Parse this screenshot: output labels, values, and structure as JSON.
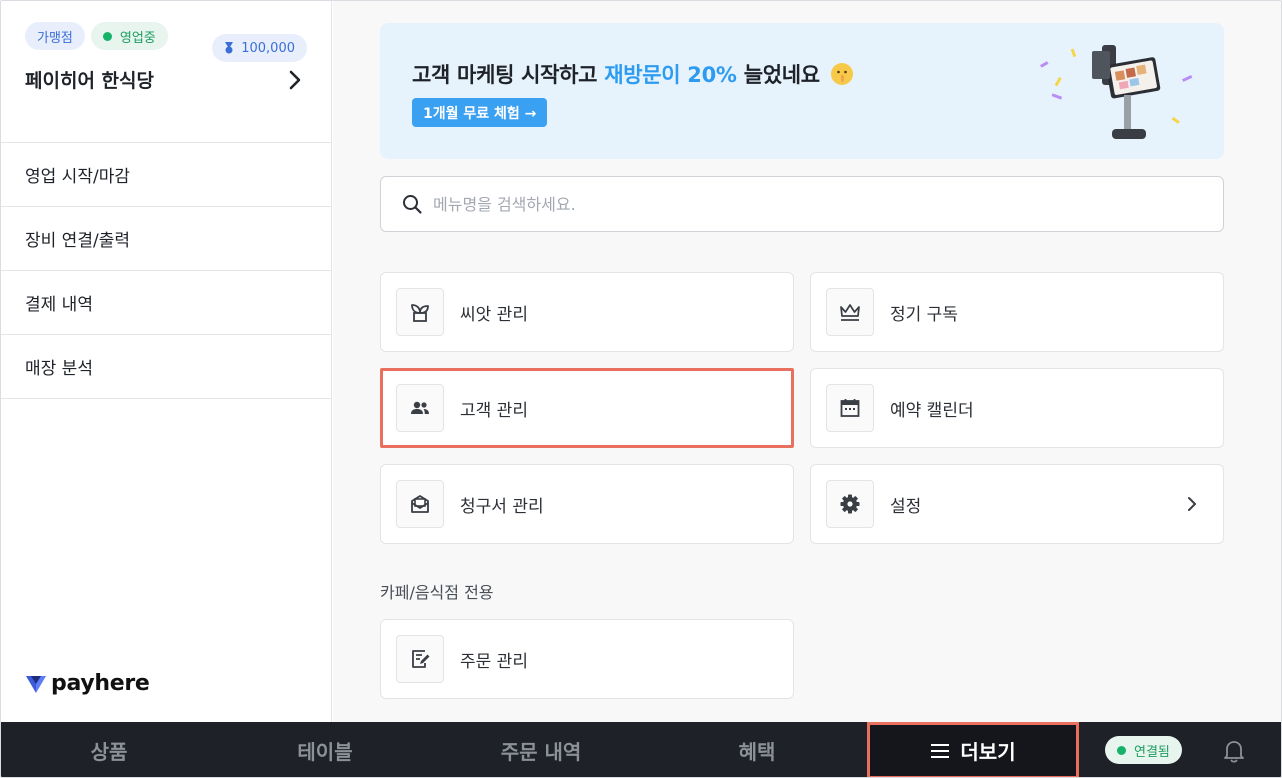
{
  "sidebar": {
    "badge_type": "가맹점",
    "badge_status": "영업중",
    "badge_points": "100,000",
    "store_name": "페이히어 한식당",
    "items": [
      {
        "label": "영업 시작/마감"
      },
      {
        "label": "장비 연결/출력"
      },
      {
        "label": "결제 내역"
      },
      {
        "label": "매장 분석"
      }
    ],
    "logo_text": "payhere"
  },
  "banner": {
    "title_part1": "고객 마케팅 시작하고 ",
    "title_highlight": "재방문이 20%",
    "title_part2": " 늘었네요",
    "button_label": "1개월 무료 체험 →"
  },
  "search": {
    "placeholder": "메뉴명을 검색하세요."
  },
  "menu": {
    "cards": [
      {
        "label": "씨앗 관리",
        "icon": "sprout-icon"
      },
      {
        "label": "정기 구독",
        "icon": "crown-icon"
      },
      {
        "label": "고객 관리",
        "icon": "people-icon"
      },
      {
        "label": "예약 캘린더",
        "icon": "calendar-icon"
      },
      {
        "label": "청구서 관리",
        "icon": "invoice-icon"
      },
      {
        "label": "설정",
        "icon": "gear-icon"
      }
    ],
    "section_label": "카페/음식점 전용",
    "section_cards": [
      {
        "label": "주문 관리",
        "icon": "order-edit-icon"
      }
    ]
  },
  "bottom_nav": {
    "tabs": [
      {
        "label": "상품"
      },
      {
        "label": "테이블"
      },
      {
        "label": "주문 내역"
      },
      {
        "label": "혜택"
      },
      {
        "label": "더보기"
      }
    ],
    "connection_status": "연결됨"
  },
  "colors": {
    "accent_blue": "#2d9cf0",
    "highlight_border": "#e9705f",
    "status_green": "#17b26a",
    "nav_bg": "#1f2128"
  }
}
